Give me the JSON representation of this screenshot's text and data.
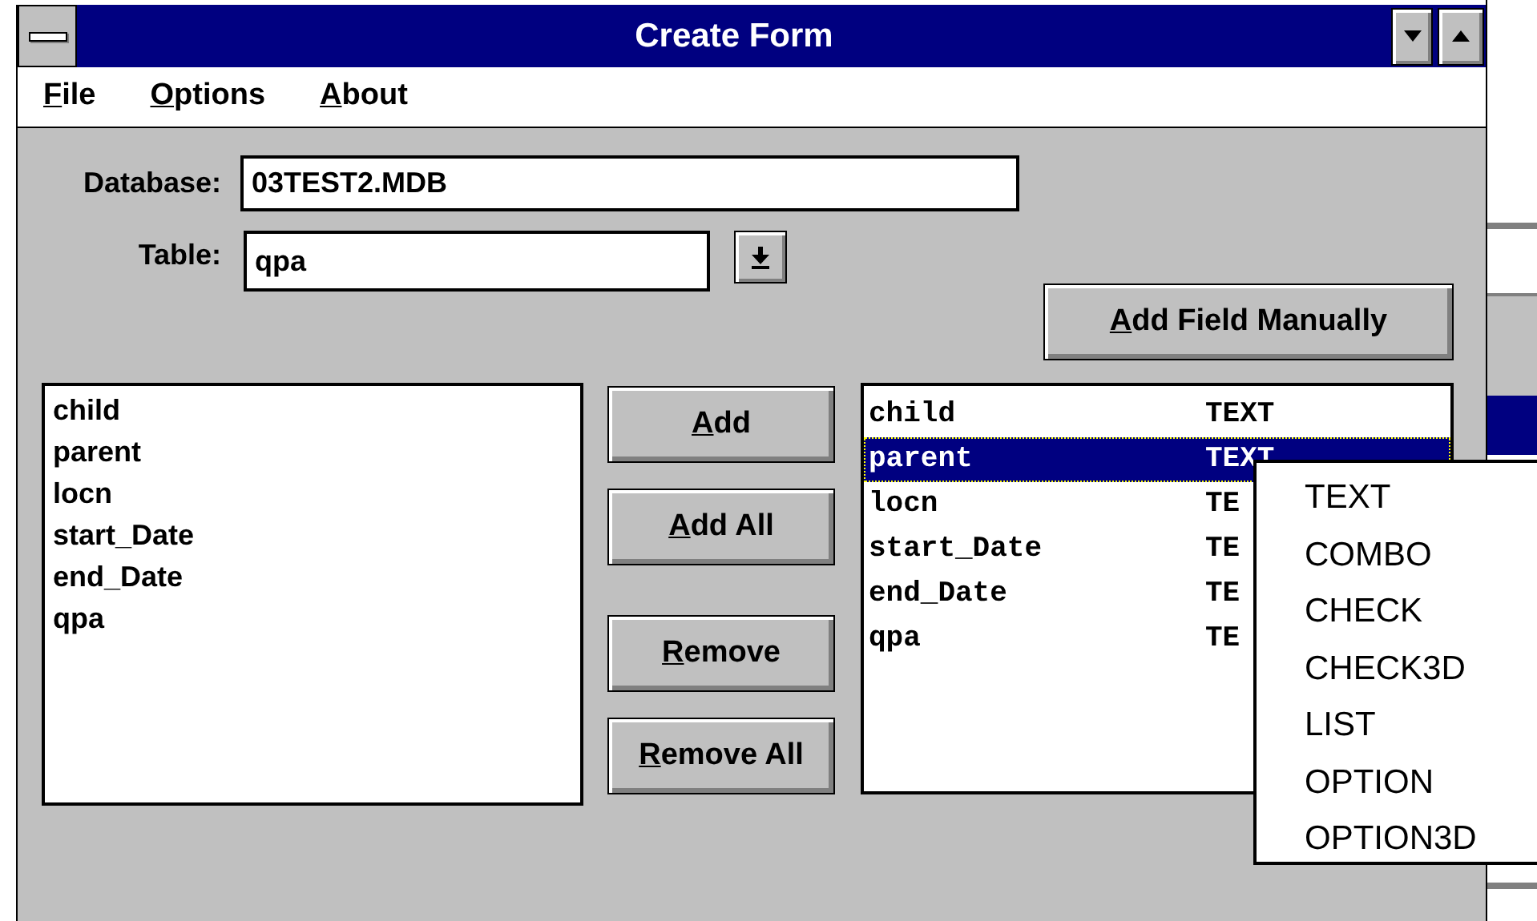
{
  "window": {
    "title": "Create Form"
  },
  "menu": [
    {
      "label": "File",
      "mnemonic": true
    },
    {
      "label": "Options",
      "mnemonic": true
    },
    {
      "label": "About",
      "mnemonic": true
    }
  ],
  "database": {
    "label": "Database:",
    "value": "03TEST2.MDB"
  },
  "table": {
    "label": "Table:",
    "value": "qpa"
  },
  "add_field_manually": {
    "label": "Add Field Manually",
    "mnemonic": true
  },
  "available_fields": [
    {
      "name": "child"
    },
    {
      "name": "parent"
    },
    {
      "name": "locn"
    },
    {
      "name": "start_Date"
    },
    {
      "name": "end_Date"
    },
    {
      "name": "qpa"
    }
  ],
  "buttons": [
    {
      "label": "Add",
      "mnemonic": true
    },
    {
      "label": "Add All",
      "mnemonic": true
    },
    {
      "label": "Remove",
      "mnemonic": true
    },
    {
      "label": "Remove All",
      "mnemonic": true
    }
  ],
  "form_fields": [
    {
      "name": "child",
      "type": "TEXT",
      "selected": false
    },
    {
      "name": "parent",
      "type": "TEXT",
      "selected": true
    },
    {
      "name": "locn",
      "type": "TE",
      "selected": false
    },
    {
      "name": "start_Date",
      "type": "TE",
      "selected": false
    },
    {
      "name": "end_Date",
      "type": "TE",
      "selected": false
    },
    {
      "name": "qpa",
      "type": "TE",
      "selected": false
    }
  ],
  "context_menu": [
    {
      "label": "TEXT"
    },
    {
      "label": "COMBO"
    },
    {
      "label": "CHECK"
    },
    {
      "label": "CHECK3D"
    },
    {
      "label": "LIST"
    },
    {
      "label": "OPTION"
    },
    {
      "label": "OPTION3D"
    }
  ]
}
